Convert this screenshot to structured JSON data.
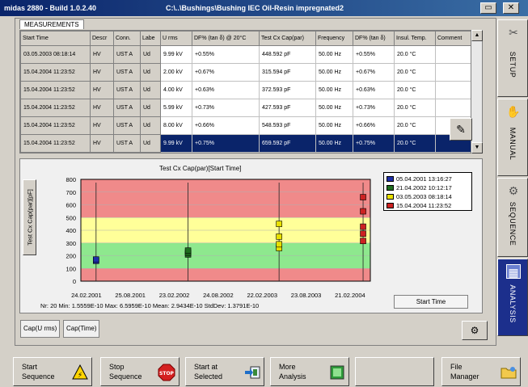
{
  "window": {
    "app_title": "midas 2880 - Build 1.0.2.40",
    "document_path": "C:\\..\\Bushings\\Bushing IEC Oil-Resin impregnated2",
    "minimize_glyph": "▭",
    "close_glyph": "✕"
  },
  "measurements": {
    "label": "MEASUREMENTS",
    "left_headers": [
      "Start Time",
      "Descr",
      "Conn.",
      "Labe"
    ],
    "headers": [
      "U rms",
      "DF% (tan δ) @ 20°C",
      "Test Cx Cap(par)",
      "Frequency",
      "DF% (tan δ)",
      "Insul. Temp.",
      "Comment"
    ],
    "rows": [
      {
        "start": "03.05.2003 08:18:14",
        "descr": "HV",
        "conn": "UST A",
        "label": "Ud",
        "urms": "9.99 kV",
        "df20": "+0.55%",
        "cap": "448.592 pF",
        "freq": "50.00 Hz",
        "df": "+0.55%",
        "temp": "20.0 °C",
        "comment": ""
      },
      {
        "start": "15.04.2004 11:23:52",
        "descr": "HV",
        "conn": "UST A",
        "label": "Ud",
        "urms": "2.00 kV",
        "df20": "+0.67%",
        "cap": "315.594 pF",
        "freq": "50.00 Hz",
        "df": "+0.67%",
        "temp": "20.0 °C",
        "comment": ""
      },
      {
        "start": "15.04.2004 11:23:52",
        "descr": "HV",
        "conn": "UST A",
        "label": "Ud",
        "urms": "4.00 kV",
        "df20": "+0.63%",
        "cap": "372.593 pF",
        "freq": "50.00 Hz",
        "df": "+0.63%",
        "temp": "20.0 °C",
        "comment": ""
      },
      {
        "start": "15.04.2004 11:23:52",
        "descr": "HV",
        "conn": "UST A",
        "label": "Ud",
        "urms": "5.99 kV",
        "df20": "+0.73%",
        "cap": "427.593 pF",
        "freq": "50.00 Hz",
        "df": "+0.73%",
        "temp": "20.0 °C",
        "comment": ""
      },
      {
        "start": "15.04.2004 11:23:52",
        "descr": "HV",
        "conn": "UST A",
        "label": "Ud",
        "urms": "8.00 kV",
        "df20": "+0.66%",
        "cap": "548.593 pF",
        "freq": "50.00 Hz",
        "df": "+0.66%",
        "temp": "20.0 °C",
        "comment": ""
      },
      {
        "start": "15.04.2004 11:23:52",
        "descr": "HV",
        "conn": "UST A",
        "label": "Ud",
        "urms": "9.99 kV",
        "df20": "+0.75%",
        "cap": "659.592 pF",
        "freq": "50.00 Hz",
        "df": "+0.75%",
        "temp": "20.0 °C",
        "comment": ""
      }
    ],
    "selected_row": 5,
    "scroll_up_glyph": "▲",
    "scroll_down_glyph": "▼",
    "edit_icon": "edit-note-icon",
    "edit_glyph": "✎"
  },
  "chart_data": {
    "type": "scatter",
    "title": "Test Cx Cap(par)[Start Time]",
    "ylabel": "Test Cx Cap(par)[pF]",
    "ylim": [
      0,
      800
    ],
    "yticks": [
      0,
      100,
      200,
      300,
      400,
      500,
      600,
      700,
      800
    ],
    "x_tick_labels": [
      "24.02.2001",
      "25.08.2001",
      "23.02.2002",
      "24.08.2002",
      "22.02.2003",
      "23.08.2003",
      "21.02.2004"
    ],
    "x_ticks": [
      "2001-02-24",
      "2001-08-25",
      "2002-02-23",
      "2002-08-24",
      "2003-02-22",
      "2003-08-23",
      "2004-02-21"
    ],
    "xlim": [
      "2001-02-01",
      "2004-05-15"
    ],
    "bands": [
      {
        "from": 0,
        "to": 100,
        "color": "#f08a8a"
      },
      {
        "from": 100,
        "to": 200,
        "color": "#8ee88e"
      },
      {
        "from": 200,
        "to": 300,
        "color": "#8ee88e"
      },
      {
        "from": 300,
        "to": 400,
        "color": "#ffff99"
      },
      {
        "from": 400,
        "to": 500,
        "color": "#ffff99"
      },
      {
        "from": 500,
        "to": 800,
        "color": "#f08a8a"
      }
    ],
    "series": [
      {
        "name": "05.04.2001 13:16:27",
        "color": "#1e2ea8",
        "points": [
          {
            "x": "2001-04-05",
            "y": 160
          },
          {
            "x": "2001-04-05",
            "y": 170
          }
        ]
      },
      {
        "name": "21.04.2002 10:12:17",
        "color": "#1f6e1f",
        "points": [
          {
            "x": "2002-04-21",
            "y": 210
          },
          {
            "x": "2002-04-21",
            "y": 225
          },
          {
            "x": "2002-04-21",
            "y": 240
          }
        ]
      },
      {
        "name": "03.05.2003 08:18:14",
        "color": "#e8e000",
        "points": [
          {
            "x": "2003-05-03",
            "y": 260
          },
          {
            "x": "2003-05-03",
            "y": 290
          },
          {
            "x": "2003-05-03",
            "y": 350
          },
          {
            "x": "2003-05-03",
            "y": 450
          }
        ]
      },
      {
        "name": "15.04.2004 11:23:52",
        "color": "#cc2222",
        "points": [
          {
            "x": "2004-04-15",
            "y": 316
          },
          {
            "x": "2004-04-15",
            "y": 373
          },
          {
            "x": "2004-04-15",
            "y": 428
          },
          {
            "x": "2004-04-15",
            "y": 549
          },
          {
            "x": "2004-04-15",
            "y": 660
          }
        ]
      }
    ]
  },
  "stats": {
    "text": "Nr: 20  Min: 1.5559E-10  Max: 6.5959E-10  Mean: 2.9434E-10  StdDev: 1.3791E-10"
  },
  "chart_controls": {
    "x_axis_button": "Start Time",
    "tab_urms": "Cap(U rms)",
    "tab_time": "Cap(Time)",
    "tools_icon": "settings-tools-icon",
    "tools_glyph": "⚙"
  },
  "side_tabs": [
    {
      "label": "SETUP",
      "icon": "wrench-icon",
      "glyph": "✂"
    },
    {
      "label": "MANUAL",
      "icon": "hand-icon",
      "glyph": "✋"
    },
    {
      "label": "SEQUENCE",
      "icon": "gear-icon",
      "glyph": "⚙"
    },
    {
      "label": "ANALYSIS",
      "icon": "analysis-icon",
      "glyph": "▦"
    }
  ],
  "bottom_buttons": [
    {
      "label": "Start\nSequence",
      "icon": "warning-triangle-icon"
    },
    {
      "label": "Stop\nSequence",
      "icon": "stop-sign-icon"
    },
    {
      "label": "Start at\nSelected",
      "icon": "arrow-into-box-icon"
    },
    {
      "label": "More\nAnalysis",
      "icon": "analysis-window-icon"
    },
    {
      "label": "",
      "icon": ""
    },
    {
      "label": "File\nManager",
      "icon": "folder-icon"
    }
  ],
  "stop_icon_text": "STOP",
  "warn_icon_text": "⚡"
}
